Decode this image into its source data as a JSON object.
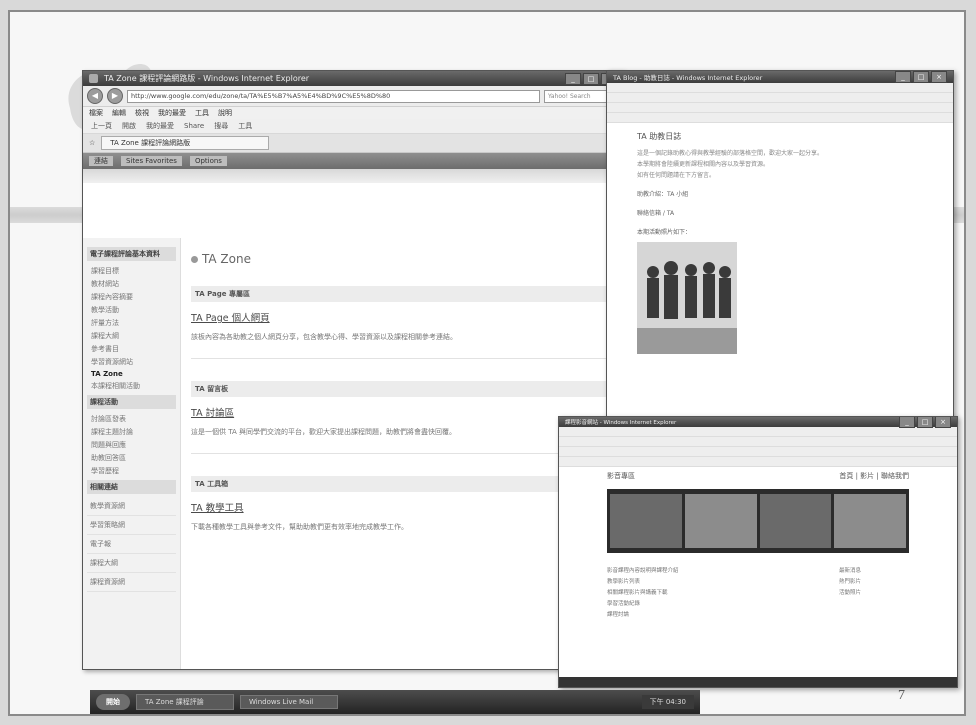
{
  "slide": {
    "page_number": "7"
  },
  "main_window": {
    "title": "TA Zone 課程評論網路版 - Windows Internet Explorer",
    "address": "http://www.google.com/edu/zone/ta/TA%E5%B7%A5%E4%BD%9C%E5%8D%80",
    "search_placeholder": "Yahoo! Search",
    "menu": [
      "檔案",
      "編輯",
      "檢視",
      "我的最愛",
      "工具",
      "說明"
    ],
    "toolbar_items": [
      "上一頁",
      "開啟",
      "我的最愛",
      "Share",
      "搜尋",
      "工具"
    ],
    "tab_label": "TA Zone 課程評論網路版",
    "page_toolbar": [
      "連結",
      "Sites Favorites",
      "Options"
    ],
    "sidebar": {
      "section1_title": "電子課程評論基本資料",
      "section1_items": [
        "課程目標",
        "教材網站",
        "課程內容摘要",
        "教學活動",
        "評量方法",
        "課程大綱",
        "參考書目",
        "學習資源網站",
        "TA Zone",
        "本課程相關活動"
      ],
      "active_item": "TA Zone",
      "section2_title": "課程活動",
      "section2_items": [
        "討論區發表",
        "課程主題討論",
        "問題與回應",
        "助教回答區",
        "學習歷程"
      ],
      "section3_title": "相關連結",
      "links": [
        "教學資源網",
        "學習策略網",
        "電子報",
        "課程大綱",
        "課程資源網"
      ]
    },
    "zone_title": "TA Zone",
    "sections": [
      {
        "header": "TA Page 專屬區",
        "link": "TA Page 個人網頁",
        "desc": "該板內容為各助教之個人網頁分享，包含教學心得、學習資源以及課程相關參考連結。"
      },
      {
        "header": "TA 留言板",
        "link": "TA 討論區",
        "desc": "這是一個供 TA 與同學們交流的平台，歡迎大家提出課程問題，助教們將會盡快回覆。"
      },
      {
        "header": "TA 工具箱",
        "link": "TA 教學工具",
        "desc": "下載各種教學工具與參考文件，幫助助教們更有效率地完成教學工作。"
      }
    ]
  },
  "blog_window": {
    "title": "TA Blog - 助教日誌 - Windows Internet Explorer",
    "heading": "TA 助教日誌",
    "lines": [
      "這是一個記錄助教心得與教學經驗的部落格空間，歡迎大家一起分享。",
      "本學期將會陸續更新課程相關內容以及學習資源。",
      "如有任何問題請在下方留言。"
    ],
    "label1": "助教介紹：TA 小組",
    "label2": "聯絡信箱 / TA",
    "label3": "本期活動照片如下："
  },
  "site_window": {
    "title": "課程影音網站 - Windows Internet Explorer",
    "site_title": "影音專區",
    "nav": "首頁 | 影片 | 聯絡我們",
    "lines": [
      "影音課程內容說明與課程介紹",
      "教學影片列表",
      "相關課程影片與講義下載",
      "學習活動紀錄",
      "課程討論"
    ],
    "side_lines": [
      "最新消息",
      "熱門影片",
      "活動照片"
    ]
  },
  "taskbar": {
    "start": "開始",
    "tasks": [
      "TA Zone 課程評論",
      "Windows Live Mail"
    ],
    "tray": "下午 04:30"
  }
}
